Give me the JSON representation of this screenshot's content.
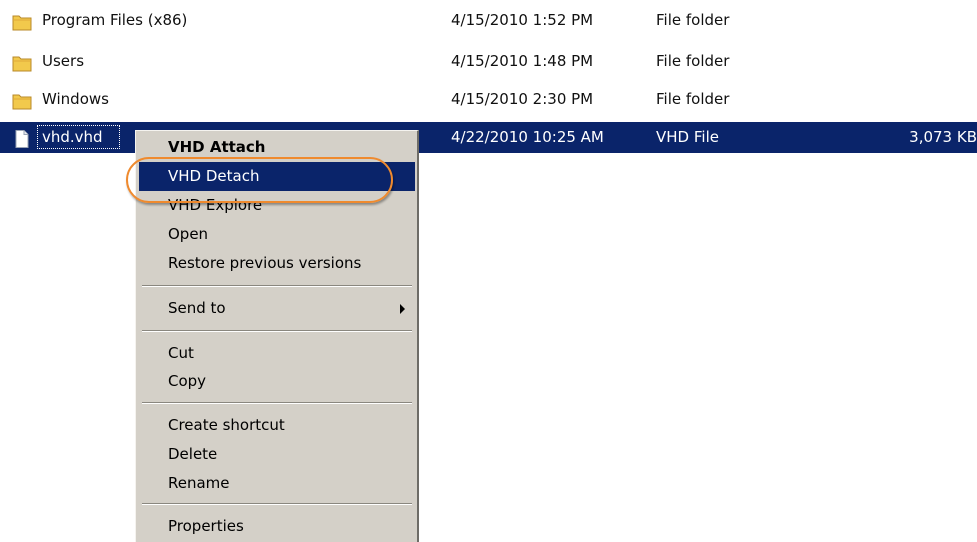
{
  "files": [
    {
      "name": "Program Files (x86)",
      "date": "4/15/2010 1:52 PM",
      "type": "File folder",
      "size": "",
      "icon": "folder-icon"
    },
    {
      "name": "Users",
      "date": "4/15/2010 1:48 PM",
      "type": "File folder",
      "size": "",
      "icon": "folder-icon"
    },
    {
      "name": "Windows",
      "date": "4/15/2010 2:30 PM",
      "type": "File folder",
      "size": "",
      "icon": "folder-icon"
    },
    {
      "name": "vhd.vhd",
      "date": "4/22/2010 10:25 AM",
      "type": "VHD File",
      "size": "3,073 KB",
      "icon": "file-icon",
      "selected": true
    }
  ],
  "context_menu": {
    "items": [
      {
        "label": "VHD Attach",
        "bold": true
      },
      {
        "label": "VHD Detach",
        "highlighted": true
      },
      {
        "label": "VHD Explore"
      },
      {
        "label": "Open"
      },
      {
        "label": "Restore previous versions"
      },
      {
        "label": "Send to",
        "submenu": true
      },
      {
        "label": "Cut"
      },
      {
        "label": "Copy"
      },
      {
        "label": "Create shortcut"
      },
      {
        "label": "Delete"
      },
      {
        "label": "Rename"
      },
      {
        "label": "Properties"
      }
    ]
  },
  "colors": {
    "selection": "#0a246a",
    "menu_background": "#d4d0c8",
    "callout": "#ef8a2e",
    "folder": "#f2c94c"
  }
}
